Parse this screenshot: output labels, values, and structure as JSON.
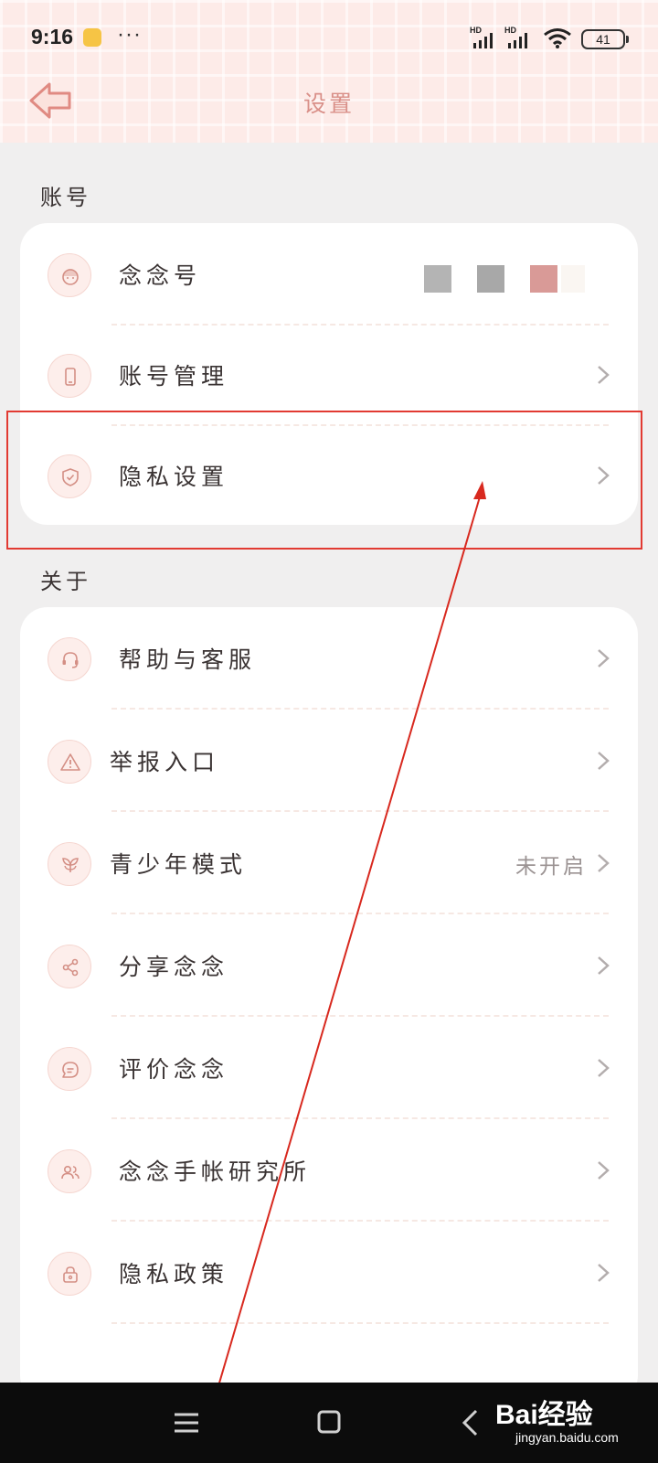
{
  "status_bar": {
    "time": "9:16",
    "dots": "···",
    "signal_badge": "HD",
    "battery": "41"
  },
  "header": {
    "title": "设置"
  },
  "sections": {
    "account": {
      "title": "账号",
      "items": [
        {
          "label": "念念号",
          "icon": "face-icon"
        },
        {
          "label": "账号管理",
          "icon": "phone-icon"
        },
        {
          "label": "隐私设置",
          "icon": "shield-check-icon"
        }
      ]
    },
    "about": {
      "title": "关于",
      "items": [
        {
          "label": "帮助与客服",
          "icon": "headset-icon"
        },
        {
          "label": "举报入口",
          "icon": "warning-icon"
        },
        {
          "label": "青少年模式",
          "icon": "sprout-icon",
          "value": "未开启"
        },
        {
          "label": "分享念念",
          "icon": "share-icon"
        },
        {
          "label": "评价念念",
          "icon": "chat-icon"
        },
        {
          "label": "念念手帐研究所",
          "icon": "users-icon"
        },
        {
          "label": "隐私政策",
          "icon": "lock-icon"
        }
      ]
    }
  },
  "colors": {
    "accent": "#d98f88",
    "highlight": "#e23a32",
    "id_squares": [
      "#b4b4b4",
      "#a8a8a8",
      "#d99a97",
      "#faf6f2"
    ]
  },
  "watermark": {
    "main": "Bai经验",
    "sub": "jingyan.baidu.com"
  }
}
